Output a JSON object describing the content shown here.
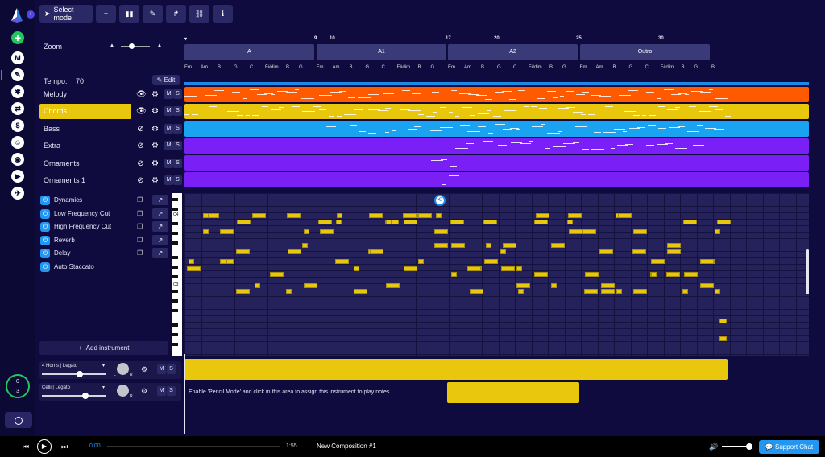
{
  "toolbar": {
    "select_label": "Select mode",
    "buttons": [
      "add-icon",
      "mixer-icon",
      "pencil-icon",
      "share-icon",
      "link-icon",
      "info-icon"
    ]
  },
  "rail": {
    "gauge_top": "0",
    "gauge_bottom": "3"
  },
  "panel": {
    "zoom_label": "Zoom",
    "tempo_label": "Tempo:",
    "tempo_value": "70",
    "edit_label": "Edit",
    "tracks": [
      {
        "name": "Melody"
      },
      {
        "name": "Chords"
      },
      {
        "name": "Bass"
      },
      {
        "name": "Extra"
      },
      {
        "name": "Ornaments"
      },
      {
        "name": "Ornaments 1"
      }
    ],
    "effects": [
      "Dynamics",
      "Low Frequency Cut",
      "High Frequency Cut",
      "Reverb",
      "Delay",
      "Auto Staccato"
    ],
    "add_instrument": "Add instrument",
    "instruments": [
      {
        "name": "4 Horns | Legato"
      },
      {
        "name": "Celli | Legato"
      }
    ],
    "mute_label": "M",
    "solo_label": "S",
    "left_label": "L",
    "right_label": "R"
  },
  "timeline": {
    "bar_numbers": [
      "9",
      "10",
      "17",
      "20",
      "25",
      "30"
    ],
    "sections": [
      "A",
      "A1",
      "A2",
      "Outro"
    ],
    "chords": [
      "Em",
      "Am",
      "B",
      "G",
      "C",
      "F#dim",
      "B",
      "G",
      "Em",
      "Am",
      "B",
      "G",
      "C",
      "F#dim",
      "B",
      "G",
      "Em",
      "Am",
      "B",
      "G",
      "C",
      "F#dim",
      "B",
      "G",
      "Em",
      "Am",
      "B",
      "G",
      "C",
      "F#dim",
      "B",
      "G",
      "B"
    ],
    "piano_labels": [
      "C4",
      "C3"
    ],
    "hint": "Enable 'Pencil Mode' and click in this area to assign this instrument to play notes."
  },
  "colors": {
    "melody": "#ff5a00",
    "chords": "#e8c70d",
    "bass": "#1aa3f0",
    "extra": "#7a1ff5",
    "ornaments": "#7a1ff5",
    "ornaments1": "#7a1ff5"
  },
  "player": {
    "current_time": "0:00",
    "duration": "1:55",
    "title": "New Composition #1",
    "support_label": "Support Chat"
  }
}
